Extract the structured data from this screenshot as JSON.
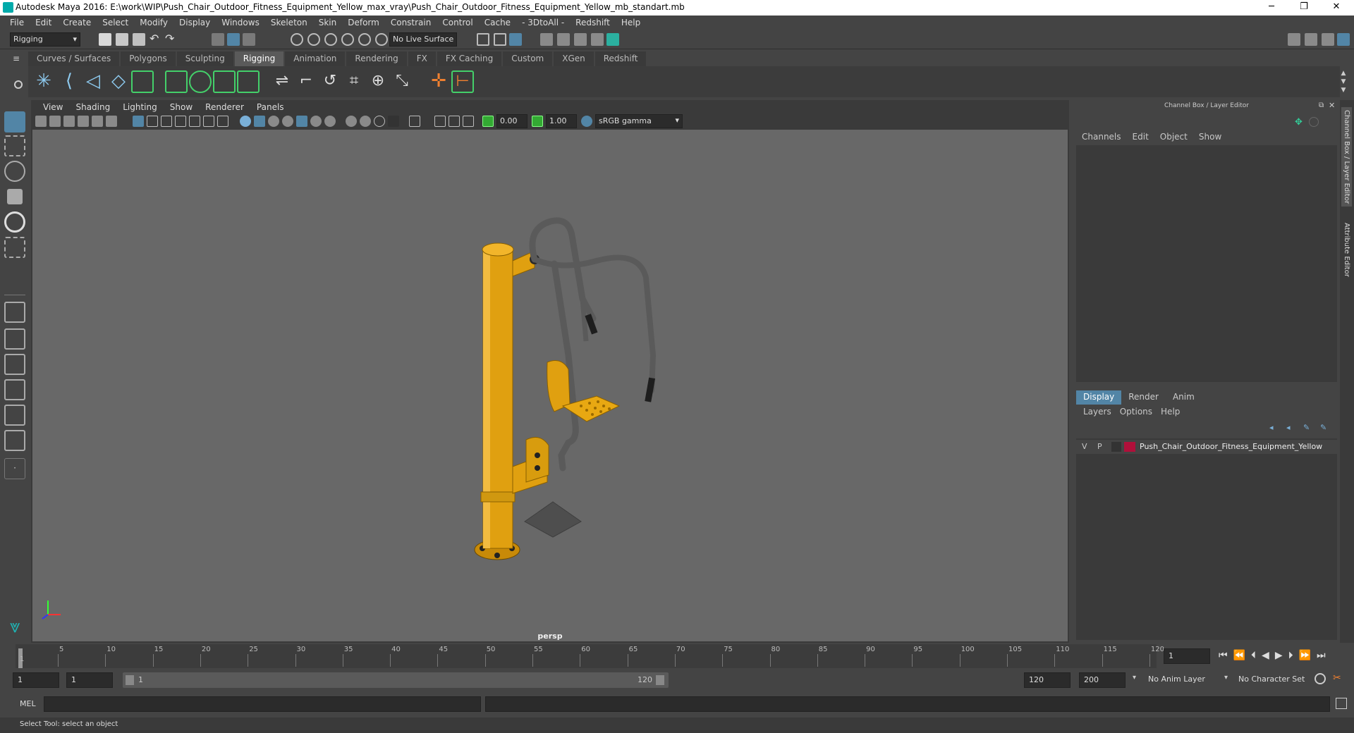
{
  "window": {
    "title": "Autodesk Maya 2016: E:\\work\\WIP\\Push_Chair_Outdoor_Fitness_Equipment_Yellow_max_vray\\Push_Chair_Outdoor_Fitness_Equipment_Yellow_mb_standart.mb",
    "minimize": "─",
    "restore": "❐",
    "close": "✕"
  },
  "menubar": [
    "File",
    "Edit",
    "Create",
    "Select",
    "Modify",
    "Display",
    "Windows",
    "Skeleton",
    "Skin",
    "Deform",
    "Constrain",
    "Control",
    "Cache",
    "- 3DtoAll -",
    "Redshift",
    "Help"
  ],
  "statusline": {
    "mode": "Rigging",
    "live_surface": "No Live Surface"
  },
  "shelf": {
    "tabs": [
      "Curves / Surfaces",
      "Polygons",
      "Sculpting",
      "Rigging",
      "Animation",
      "Rendering",
      "FX",
      "FX Caching",
      "Custom",
      "XGen",
      "Redshift"
    ],
    "active": "Rigging"
  },
  "viewport": {
    "menu": [
      "View",
      "Shading",
      "Lighting",
      "Show",
      "Renderer",
      "Panels"
    ],
    "exposure": "0.00",
    "gamma": "1.00",
    "color_space": "sRGB gamma",
    "camera": "persp"
  },
  "channelbox": {
    "title": "Channel Box / Layer Editor",
    "menu": [
      "Channels",
      "Edit",
      "Object",
      "Show"
    ],
    "layer_tabs": [
      "Display",
      "Render",
      "Anim"
    ],
    "layer_tab_active": "Display",
    "layer_menu": [
      "Layers",
      "Options",
      "Help"
    ],
    "layer": {
      "v": "V",
      "p": "P",
      "name": "Push_Chair_Outdoor_Fitness_Equipment_Yellow",
      "color": "#b0103a"
    }
  },
  "sidetabs": [
    "Channel Box / Layer Editor",
    "Attribute Editor"
  ],
  "timeline": {
    "ticks": [
      "5",
      "10",
      "15",
      "20",
      "25",
      "30",
      "35",
      "40",
      "45",
      "50",
      "55",
      "60",
      "65",
      "70",
      "75",
      "80",
      "85",
      "90",
      "95",
      "100",
      "105",
      "110",
      "115",
      "120"
    ],
    "start_marker": "1",
    "current_frame": "1"
  },
  "range": {
    "start": "1",
    "playback_start": "1",
    "slider_start": "1",
    "slider_end": "120",
    "playback_end": "120",
    "end": "200",
    "anim_layer": "No Anim Layer",
    "character_set": "No Character Set"
  },
  "mel": {
    "label": "MEL"
  },
  "help": {
    "text": "Select Tool: select an object"
  },
  "colors": {
    "accent": "#5285a6",
    "model_yellow": "#e0a010",
    "model_pipe": "#5a5a5a"
  }
}
